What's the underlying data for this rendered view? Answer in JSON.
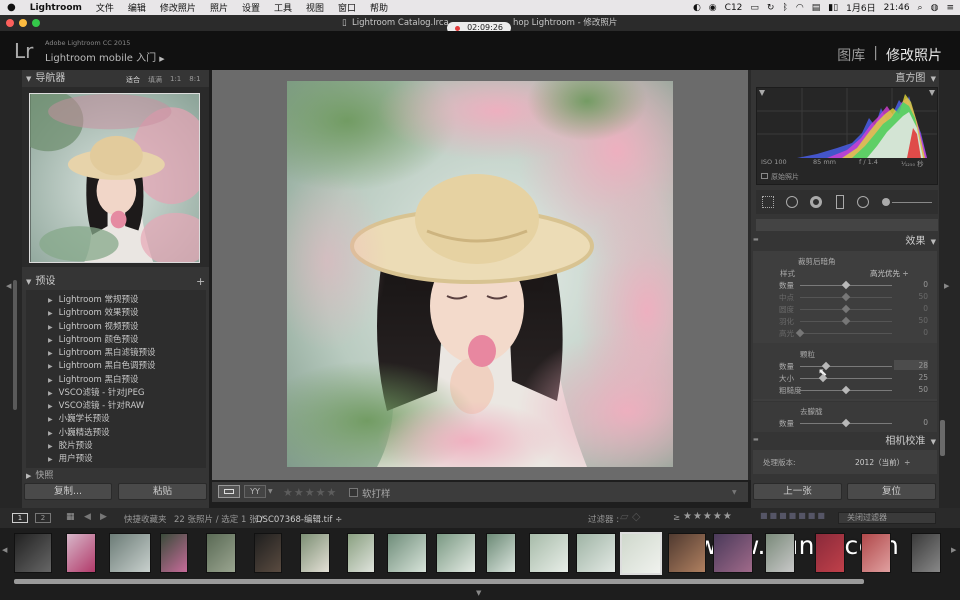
{
  "menubar": {
    "apple": "",
    "app": "Lightroom",
    "items": [
      "文件",
      "编辑",
      "修改照片",
      "照片",
      "设置",
      "工具",
      "视图",
      "窗口",
      "帮助"
    ],
    "status_c12": "C12",
    "date": "1月6日",
    "time": "21:46"
  },
  "window": {
    "title_left": "Lightroom Catalog.lrca",
    "title_right": "hop Lightroom - 修改照片",
    "recording_time": "02:09:26"
  },
  "identity": {
    "logo": "Lr",
    "product": "Adobe Lightroom CC 2015",
    "mobile": "Lightroom mobile 入门",
    "mobile_arrow": "▶"
  },
  "modules": {
    "library": "图库",
    "sep": "|",
    "develop": "修改照片"
  },
  "navigator": {
    "title": "导航器",
    "zoom_options": [
      "适合",
      "填满",
      "1:1",
      "8:1"
    ]
  },
  "presets": {
    "title": "预设",
    "add": "+",
    "items": [
      "Lightroom 常规预设",
      "Lightroom 效果预设",
      "Lightroom 视频预设",
      "Lightroom 颜色预设",
      "Lightroom 黑白滤镜预设",
      "Lightroom 黑白色调预设",
      "Lightroom 黑白预设",
      "VSCO滤镜 - 针对JPEG",
      "VSCO滤镜 - 针对RAW",
      "小巍学长预设",
      "小巍精选预设",
      "胶片预设",
      "用户预设"
    ],
    "next_section_partial": "快照"
  },
  "left_buttons": {
    "copy": "复制...",
    "paste": "粘贴"
  },
  "toolbar": {
    "stars": "★★★★★",
    "soft_proof": "软打样"
  },
  "histogram": {
    "title": "直方图",
    "iso": "ISO 100",
    "focal": "85 mm",
    "aperture": "f / 1.4",
    "shutter": "¹⁄₁₂₅₀ 秒",
    "original": "原始照片"
  },
  "effects": {
    "title": "效果",
    "vignette_title": "裁剪后暗角",
    "style_label": "样式",
    "style_value": "高光优先 ÷",
    "vignette": [
      {
        "label": "数量",
        "value": "0",
        "knob": 0.5,
        "dim": false
      },
      {
        "label": "中点",
        "value": "50",
        "knob": 0.5,
        "dim": true
      },
      {
        "label": "圆度",
        "value": "0",
        "knob": 0.5,
        "dim": true
      },
      {
        "label": "羽化",
        "value": "50",
        "knob": 0.5,
        "dim": true
      },
      {
        "label": "高光",
        "value": "0",
        "knob": 0.0,
        "dim": true
      }
    ],
    "grain_title": "颗粒",
    "grain": [
      {
        "label": "数量",
        "value": "28",
        "knob": 0.28,
        "dim": false
      },
      {
        "label": "大小",
        "value": "25",
        "knob": 0.25,
        "dim": false
      },
      {
        "label": "粗糙度",
        "value": "50",
        "knob": 0.5,
        "dim": false
      }
    ],
    "dehaze_title": "去朦胧",
    "dehaze": [
      {
        "label": "数量",
        "value": "0",
        "knob": 0.5,
        "dim": false
      }
    ]
  },
  "camera_calibration": {
    "title": "相机校准",
    "process_label": "处理版本:",
    "process_value": "2012（当前）÷"
  },
  "right_buttons": {
    "previous": "上一张",
    "reset": "复位"
  },
  "filmstrip_bar": {
    "views": [
      "1",
      "2"
    ],
    "source": "快捷收藏夹",
    "count": "22 张照片 / 选定 1 张 /",
    "filename": "DSC07368-编辑.tif ÷",
    "filter_label": "过滤器 :",
    "rating_op": "≥",
    "stars": "★★★★★",
    "filter_off": "关闭过滤器"
  },
  "watermark": "www.hunls.com"
}
